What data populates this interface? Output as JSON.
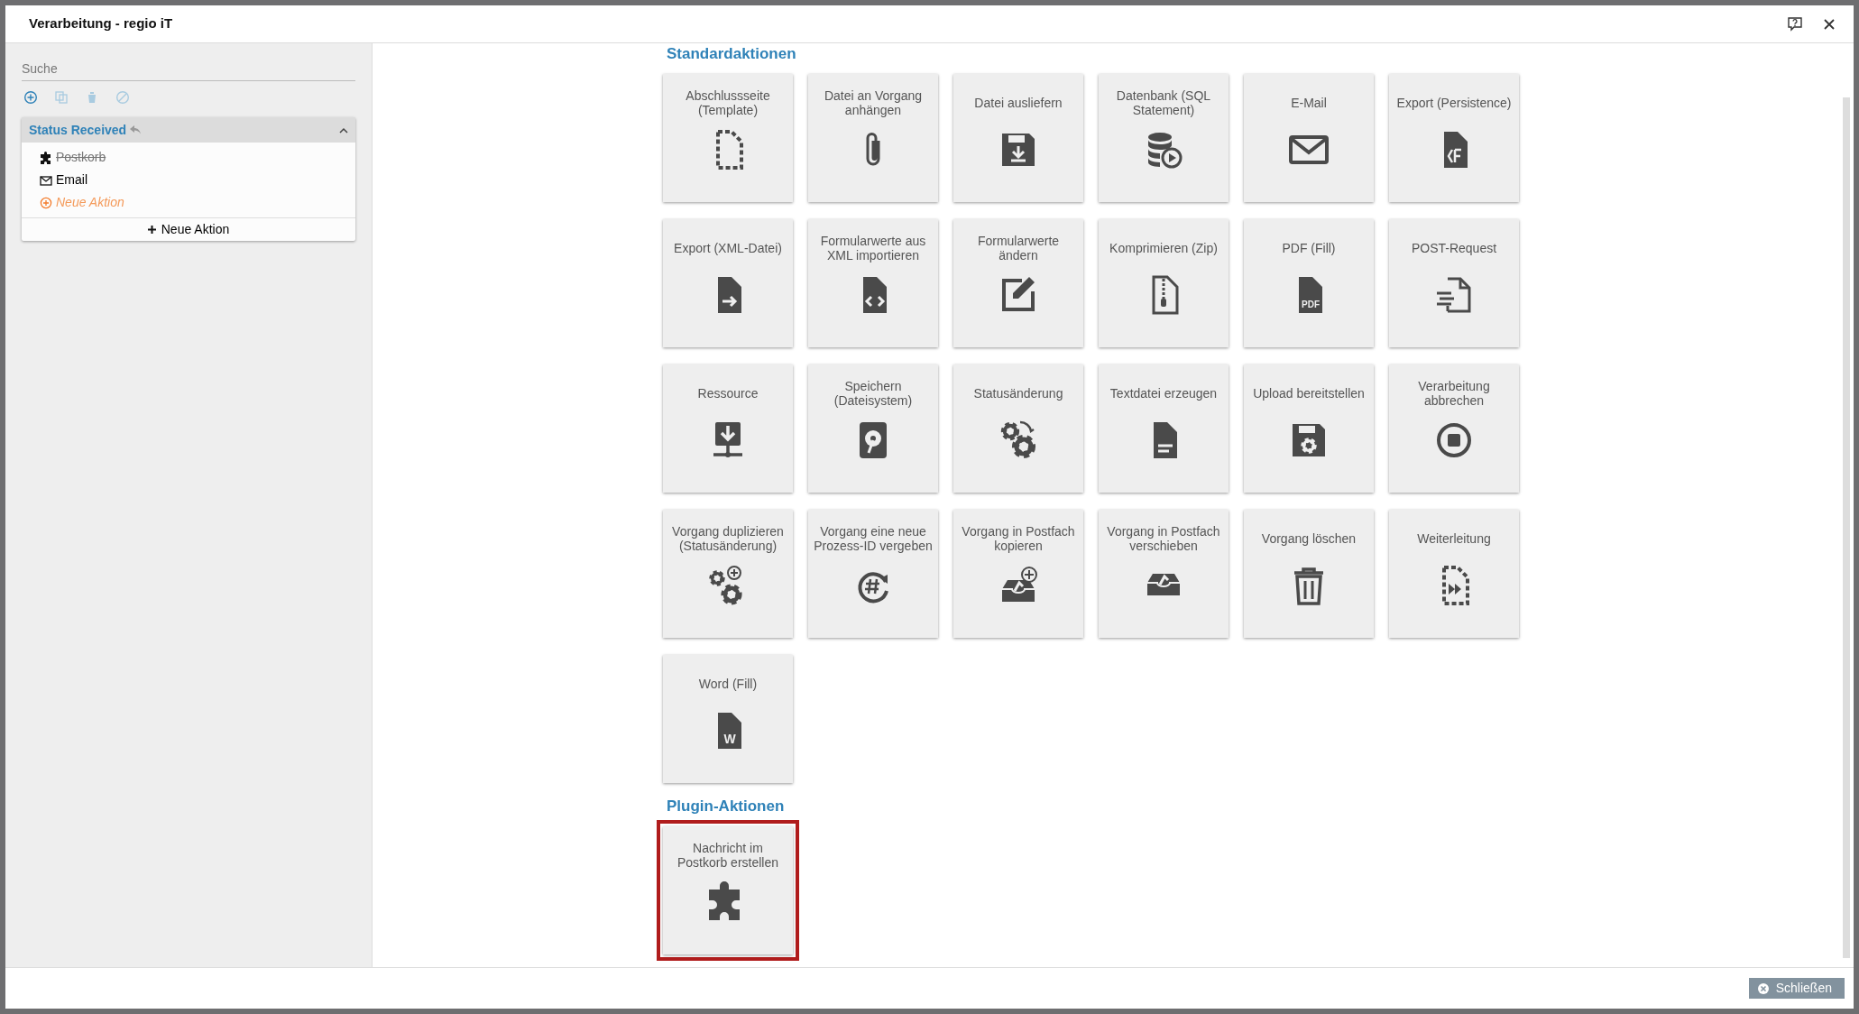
{
  "window": {
    "title": "Verarbeitung - regio iT"
  },
  "sidebar": {
    "search": {
      "placeholder": "Suche"
    },
    "toolbar": [
      {
        "disabled": false
      },
      {
        "disabled": true
      },
      {
        "disabled": true
      },
      {
        "disabled": true
      }
    ],
    "group": {
      "title": "Status Received",
      "expanded": true,
      "items": [
        {
          "kind": "action",
          "label": "Postkorb",
          "disabled": true
        },
        {
          "kind": "action",
          "label": "Email",
          "disabled": false
        },
        {
          "kind": "new",
          "label": "Neue Aktion",
          "disabled": false
        }
      ],
      "add_button": "Neue Aktion"
    }
  },
  "sections": [
    {
      "title": "Standardaktionen",
      "tiles": [
        {
          "label": "Abschlussseite (Template)",
          "selected": false
        },
        {
          "label": "Datei an Vorgang anhängen",
          "selected": false
        },
        {
          "label": "Datei ausliefern",
          "selected": false
        },
        {
          "label": "Datenbank (SQL Statement)",
          "selected": false
        },
        {
          "label": "E-Mail",
          "selected": false
        },
        {
          "label": "Export (Persistence)",
          "selected": false
        },
        {
          "label": "Export (XML-Datei)",
          "selected": false
        },
        {
          "label": "Formularwerte aus XML importieren",
          "selected": false
        },
        {
          "label": "Formularwerte ändern",
          "selected": false
        },
        {
          "label": "Komprimieren (Zip)",
          "selected": false
        },
        {
          "label": "PDF (Fill)",
          "selected": false,
          "icon_text": "PDF"
        },
        {
          "label": "POST-Request",
          "selected": false
        },
        {
          "label": "Ressource",
          "selected": false
        },
        {
          "label": "Speichern (Dateisystem)",
          "selected": false
        },
        {
          "label": "Statusänderung",
          "selected": false
        },
        {
          "label": "Textdatei erzeugen",
          "selected": false
        },
        {
          "label": "Upload bereitstellen",
          "selected": false
        },
        {
          "label": "Verarbeitung abbrechen",
          "selected": false
        },
        {
          "label": "Vorgang duplizieren (Statusänderung)",
          "selected": false
        },
        {
          "label": "Vorgang eine neue Prozess-ID vergeben",
          "selected": false
        },
        {
          "label": "Vorgang in Postfach kopieren",
          "selected": false
        },
        {
          "label": "Vorgang in Postfach verschieben",
          "selected": false
        },
        {
          "label": "Vorgang löschen",
          "selected": false
        },
        {
          "label": "Weiterleitung",
          "selected": false
        },
        {
          "label": "Word (Fill)",
          "selected": false,
          "icon_text": "W"
        }
      ]
    },
    {
      "title": "Plugin-Aktionen",
      "tiles": [
        {
          "label": "Nachricht im Postkorb erstellen",
          "selected": true
        }
      ]
    }
  ],
  "footer": {
    "close_button": "Schließen"
  }
}
